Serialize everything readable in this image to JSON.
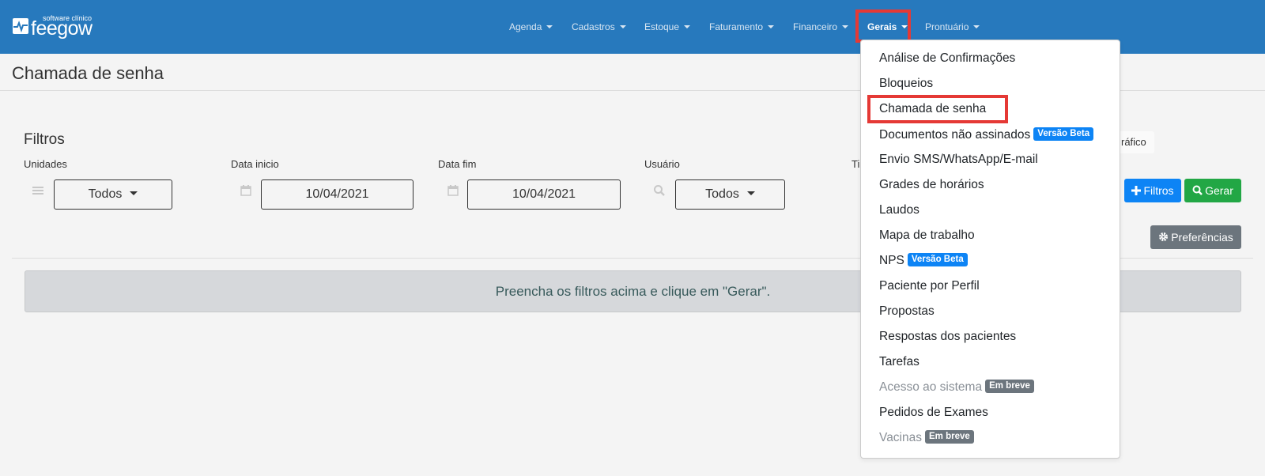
{
  "app": {
    "logo_small": "software clínico",
    "logo_big": "feegow"
  },
  "nav": {
    "items": [
      {
        "label": "Agenda"
      },
      {
        "label": "Cadastros"
      },
      {
        "label": "Estoque"
      },
      {
        "label": "Faturamento"
      },
      {
        "label": "Financeiro"
      },
      {
        "label": "Gerais",
        "active": true
      },
      {
        "label": "Prontuário"
      }
    ]
  },
  "page": {
    "title": "Chamada de senha"
  },
  "filters": {
    "title": "Filtros",
    "unidades": {
      "label": "Unidades",
      "value": "Todos",
      "icon": "list-icon"
    },
    "data_inicio": {
      "label": "Data inicio",
      "value": "10/04/2021",
      "icon": "calendar-icon"
    },
    "data_fim": {
      "label": "Data fim",
      "value": "10/04/2021",
      "icon": "calendar-icon"
    },
    "usuario": {
      "label": "Usuário",
      "value": "Todos",
      "icon": "search-icon"
    },
    "tipo_label_partial": "Ti",
    "grafico_partial": "ráfico"
  },
  "buttons": {
    "filtros": "Filtros",
    "gerar": "Gerar",
    "preferencias": "Preferências"
  },
  "alert": {
    "message": "Preencha os filtros acima e clique em \"Gerar\"."
  },
  "dropdown": {
    "items": [
      {
        "label": "Análise de Confirmações"
      },
      {
        "label": "Bloqueios"
      },
      {
        "label": "Chamada de senha",
        "highlighted": true
      },
      {
        "label": "Documentos não assinados",
        "badge": "Versão Beta"
      },
      {
        "label": "Envio SMS/WhatsApp/E-mail"
      },
      {
        "label": "Grades de horários"
      },
      {
        "label": "Laudos"
      },
      {
        "label": "Mapa de trabalho"
      },
      {
        "label": "NPS",
        "badge": "Versão Beta"
      },
      {
        "label": "Paciente por Perfil"
      },
      {
        "label": "Propostas"
      },
      {
        "label": "Respostas dos pacientes"
      },
      {
        "label": "Tarefas"
      },
      {
        "label": "Acesso ao sistema",
        "badge": "Em breve",
        "disabled": true
      },
      {
        "label": "Pedidos de Exames"
      },
      {
        "label": "Vacinas",
        "badge": "Em breve",
        "disabled": true
      }
    ]
  },
  "colors": {
    "topbar": "#2779bd",
    "highlight": "#e53935",
    "primary": "#0d84f5",
    "success": "#22a745",
    "secondary": "#6c757d"
  }
}
